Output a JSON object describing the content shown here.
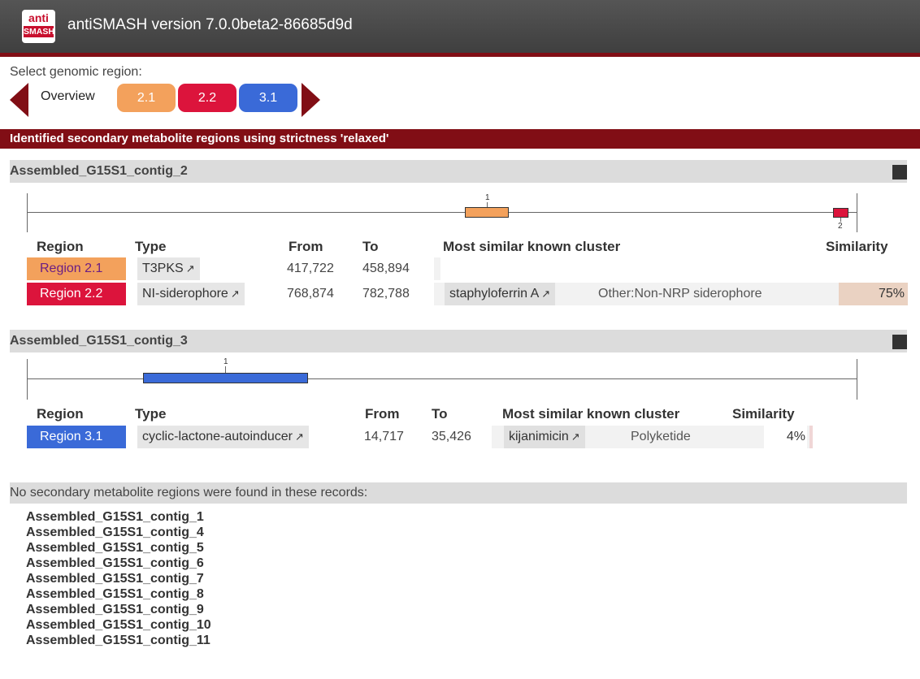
{
  "header": {
    "logo_top": "anti",
    "logo_bottom": "SMASH",
    "title": "antiSMASH version 7.0.0beta2-86685d9d"
  },
  "nav": {
    "select_label": "Select genomic region:",
    "overview": "Overview",
    "regions": [
      "2.1",
      "2.2",
      "3.1"
    ]
  },
  "section_title": "Identified secondary metabolite regions using strictness 'relaxed'",
  "records": [
    {
      "name": "Assembled_G15S1_contig_2",
      "track_labels": [
        "1",
        "2"
      ],
      "headers": {
        "region": "Region",
        "type": "Type",
        "from": "From",
        "to": "To",
        "cluster": "Most similar known cluster",
        "similarity": "Similarity"
      },
      "rows": [
        {
          "region": "Region 2.1",
          "type": "T3PKS",
          "from": "417,722",
          "to": "458,894",
          "cluster": "",
          "cluster_type": "",
          "similarity": "",
          "similarity_value": 0
        },
        {
          "region": "Region 2.2",
          "type": "NI-siderophore",
          "from": "768,874",
          "to": "782,788",
          "cluster": "staphyloferrin A",
          "cluster_type": "Other:Non-NRP siderophore",
          "similarity": "75%",
          "similarity_value": 75
        }
      ]
    },
    {
      "name": "Assembled_G15S1_contig_3",
      "track_labels": [
        "1"
      ],
      "headers": {
        "region": "Region",
        "type": "Type",
        "from": "From",
        "to": "To",
        "cluster": "Most similar known cluster",
        "similarity": "Similarity"
      },
      "rows": [
        {
          "region": "Region 3.1",
          "type": "cyclic-lactone-autoinducer",
          "from": "14,717",
          "to": "35,426",
          "cluster": "kijanimicin",
          "cluster_type": "Polyketide",
          "similarity": "4%",
          "similarity_value": 4
        }
      ]
    }
  ],
  "colors": {
    "accent": "#810e15",
    "region_2_1": "#f3a15c",
    "region_2_2": "#dc143c",
    "region_3_1": "#3a6ad8"
  },
  "no_regions": {
    "label": "No secondary metabolite regions were found in these records:",
    "records": [
      "Assembled_G15S1_contig_1",
      "Assembled_G15S1_contig_4",
      "Assembled_G15S1_contig_5",
      "Assembled_G15S1_contig_6",
      "Assembled_G15S1_contig_7",
      "Assembled_G15S1_contig_8",
      "Assembled_G15S1_contig_9",
      "Assembled_G15S1_contig_10",
      "Assembled_G15S1_contig_11"
    ]
  },
  "icons": {
    "external_link": "external-link-icon",
    "toggle": "toggle-square-icon"
  }
}
